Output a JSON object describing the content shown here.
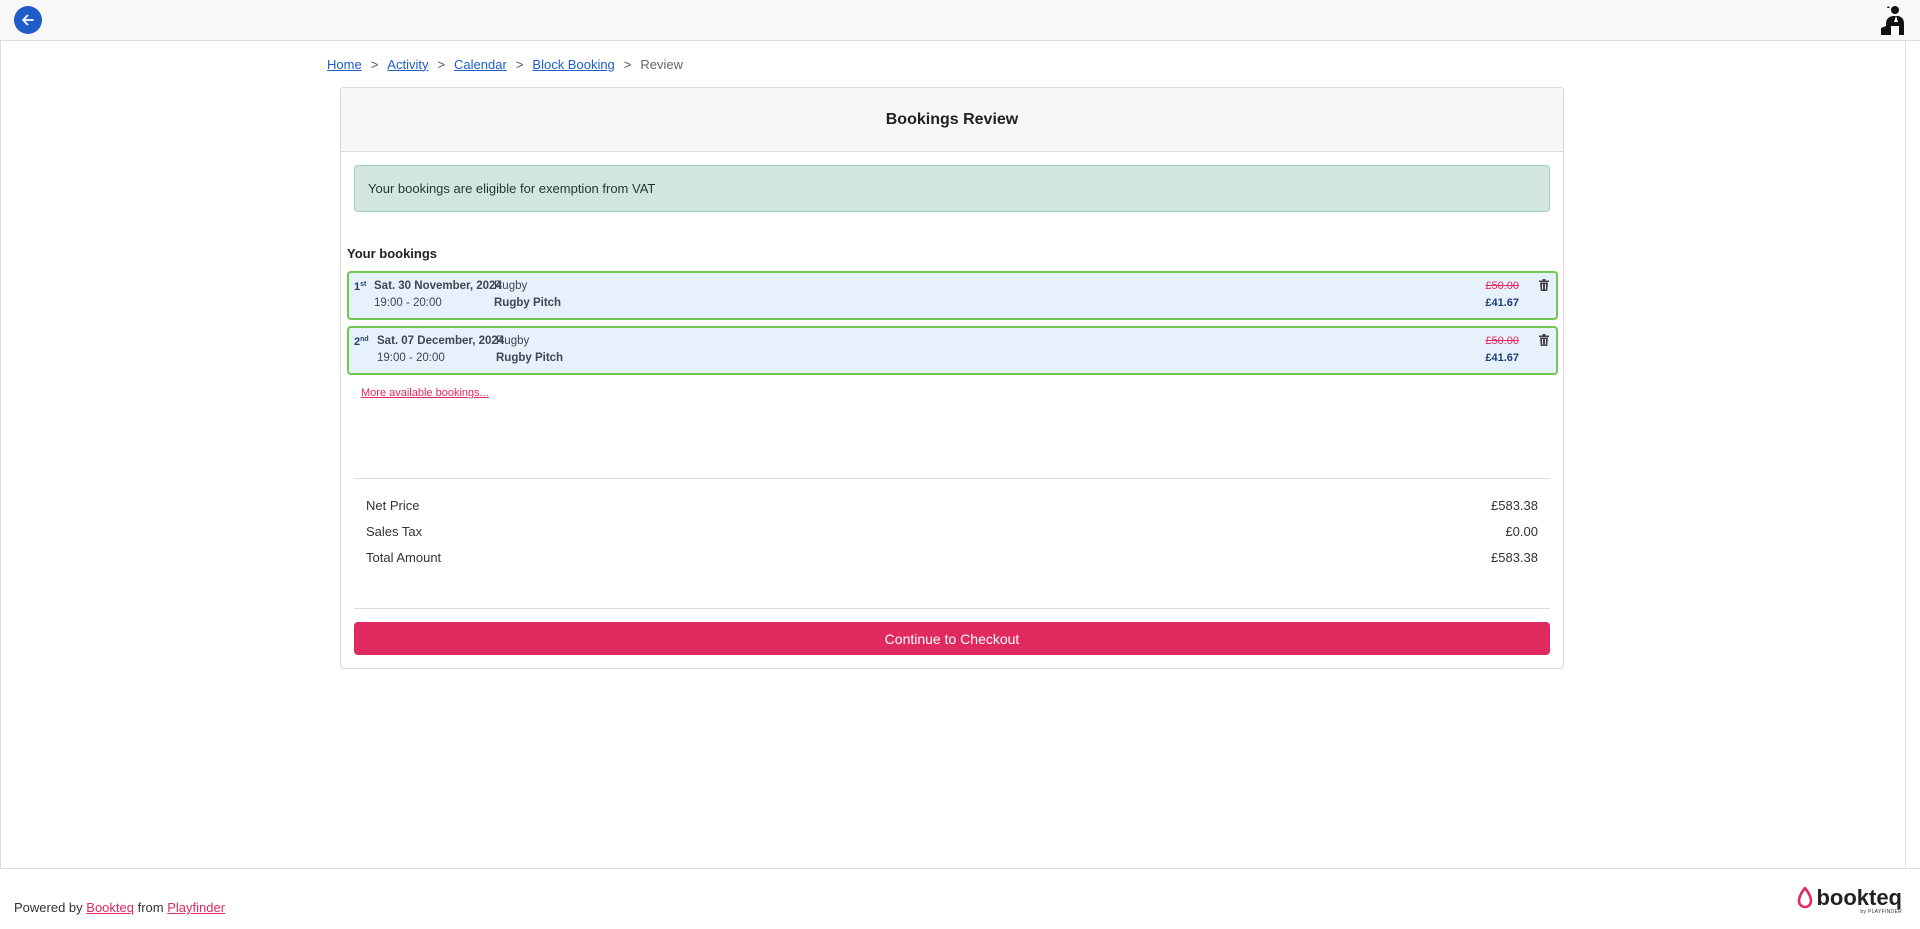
{
  "header": {
    "back_icon": "arrow-left-icon",
    "avatar_icon": "user-avatar-icon"
  },
  "breadcrumb": {
    "items": [
      "Home",
      "Activity",
      "Calendar",
      "Block Booking"
    ],
    "separator": ">",
    "current": "Review"
  },
  "card": {
    "title": "Bookings Review",
    "vat_notice": "Your bookings are eligible for exemption from VAT",
    "section_title": "Your bookings",
    "bookings": [
      {
        "ordinal_num": "1",
        "ordinal_suffix": "st",
        "date": "Sat. 30 November, 2024",
        "time": "19:00 - 20:00",
        "activity": "Rugby",
        "facility": "Rugby Pitch",
        "old_price": "£50.00",
        "new_price": "£41.67"
      },
      {
        "ordinal_num": "2",
        "ordinal_suffix": "nd",
        "date": "Sat. 07 December, 2024",
        "time": "19:00 - 20:00",
        "activity": "Rugby",
        "facility": "Rugby Pitch",
        "old_price": "£50.00",
        "new_price": "£41.67"
      }
    ],
    "more_link": "More available bookings...",
    "totals": {
      "net_label": "Net Price",
      "net_value": "£583.38",
      "tax_label": "Sales Tax",
      "tax_value": "£0.00",
      "total_label": "Total Amount",
      "total_value": "£583.38"
    },
    "checkout_label": "Continue to Checkout"
  },
  "footer": {
    "powered_prefix": "Powered by",
    "powered_link1": "Bookteq",
    "powered_middle": "from",
    "powered_link2": "Playfinder",
    "logo_text": "bookteq",
    "logo_sub": "by PLAYFINDER"
  },
  "colors": {
    "primary": "#1f5cc7",
    "accent": "#e0295e",
    "success_bg": "#d1e7dd",
    "booking_bg": "#e6f1fc",
    "booking_border": "#72c74f"
  }
}
